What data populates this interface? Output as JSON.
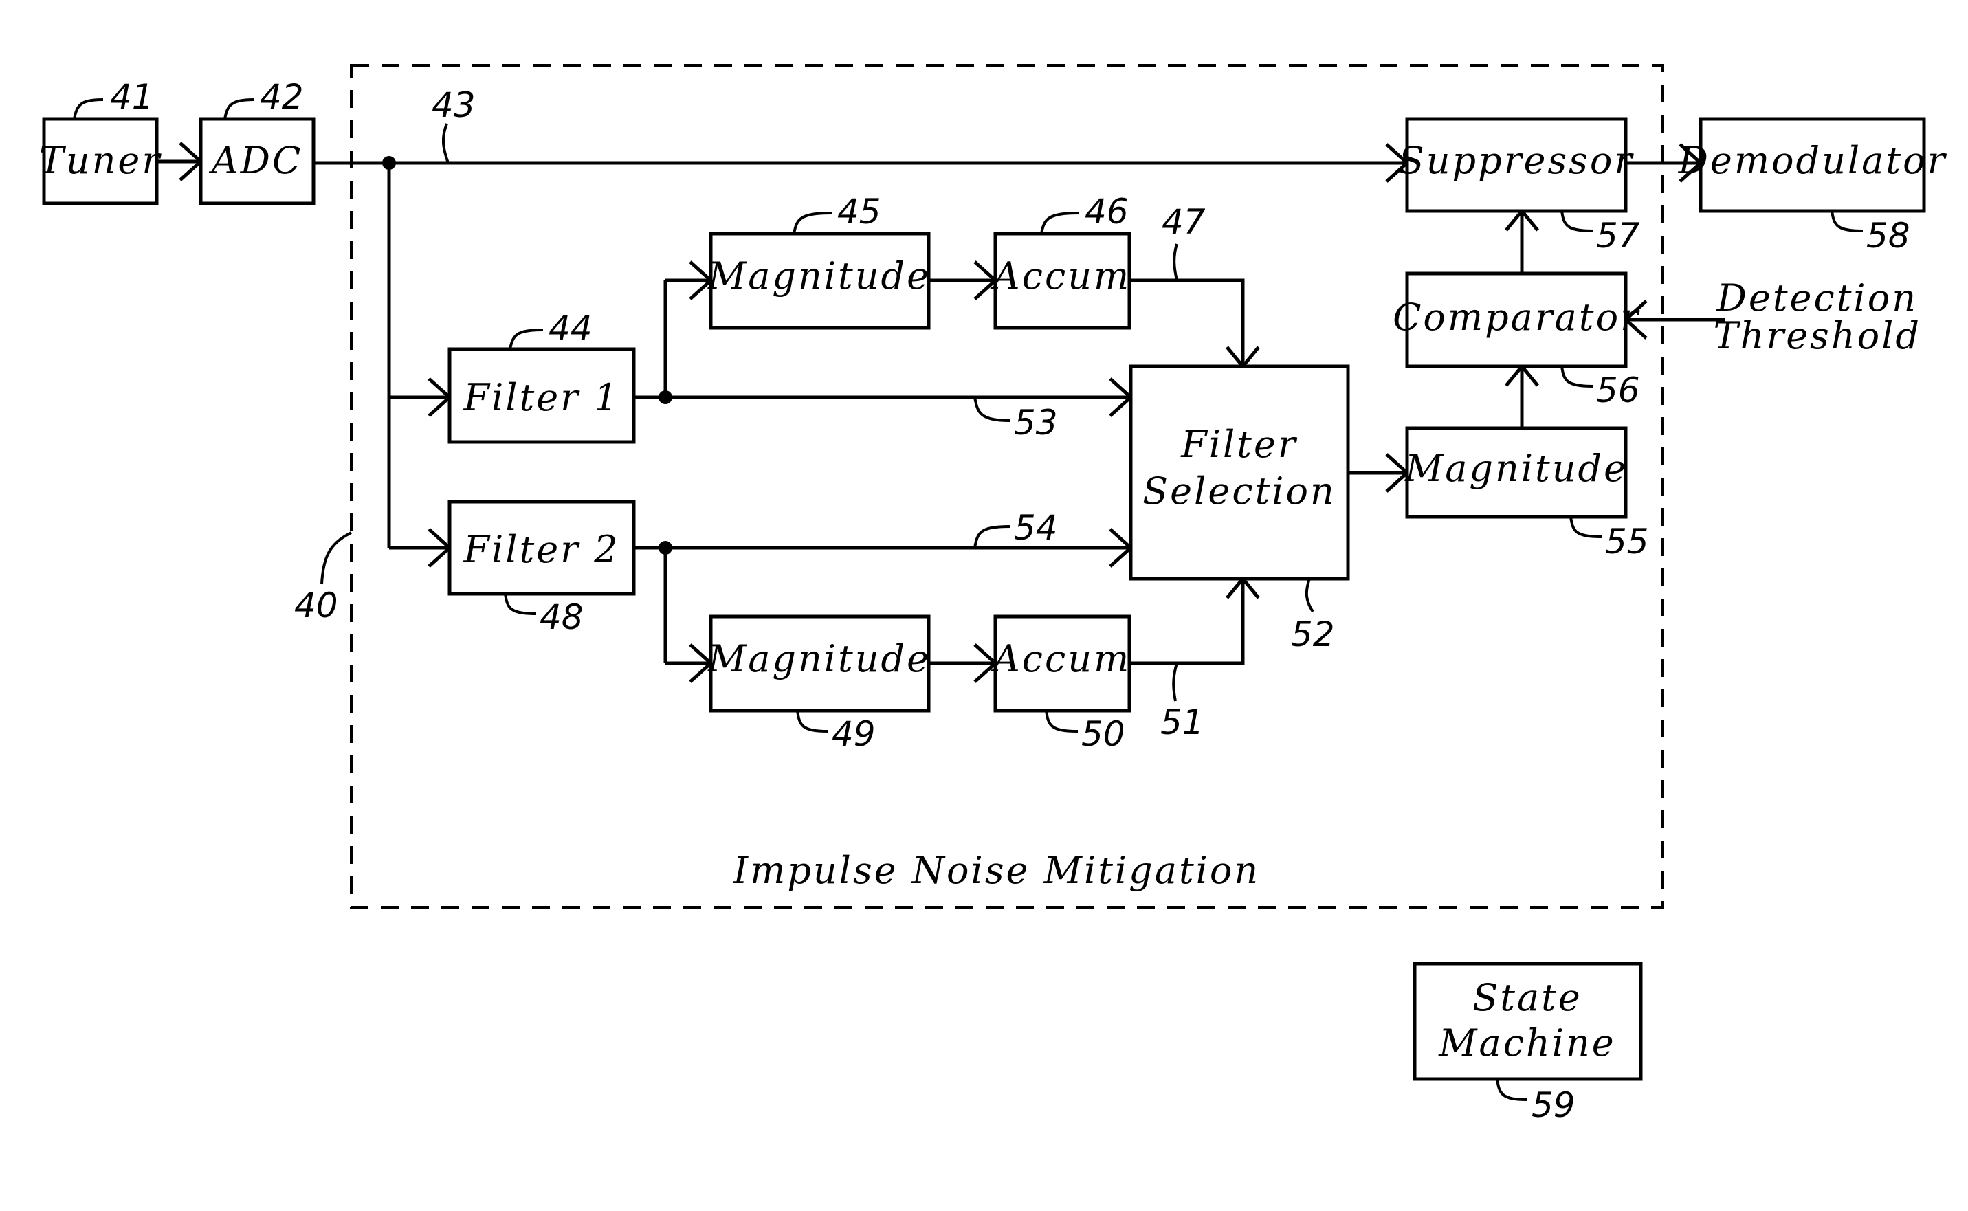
{
  "diagram": {
    "group": {
      "label": "Impulse Noise Mitigation",
      "ref": "40"
    },
    "blocks": {
      "tuner": {
        "label": "Tuner",
        "ref": "41"
      },
      "adc": {
        "label": "ADC",
        "ref": "42"
      },
      "filter1": {
        "label": "Filter 1",
        "ref": "44"
      },
      "magnitude_top": {
        "label": "Magnitude",
        "ref": "45"
      },
      "accum_top": {
        "label": "Accum",
        "ref": "46"
      },
      "filter2": {
        "label": "Filter 2",
        "ref": "48"
      },
      "magnitude_bottom": {
        "label": "Magnitude",
        "ref": "49"
      },
      "accum_bottom": {
        "label": "Accum",
        "ref": "50"
      },
      "filter_selection": {
        "line1": "Filter",
        "line2": "Selection",
        "ref": "52"
      },
      "magnitude_out": {
        "label": "Magnitude",
        "ref": "55"
      },
      "comparator": {
        "label": "Comparator",
        "ref": "56"
      },
      "suppressor": {
        "label": "Suppressor",
        "ref": "57"
      },
      "demodulator": {
        "label": "Demodulator",
        "ref": "58"
      },
      "state_machine": {
        "line1": "State",
        "line2": "Machine",
        "ref": "59"
      }
    },
    "signals": {
      "bypass": {
        "ref": "43"
      },
      "accum_top_out": {
        "ref": "47"
      },
      "accum_bottom_out": {
        "ref": "51"
      },
      "filter1_out": {
        "ref": "53"
      },
      "filter2_out": {
        "ref": "54"
      }
    },
    "inputs": {
      "detection_threshold": {
        "line1": "Detection",
        "line2": "Threshold"
      }
    }
  }
}
